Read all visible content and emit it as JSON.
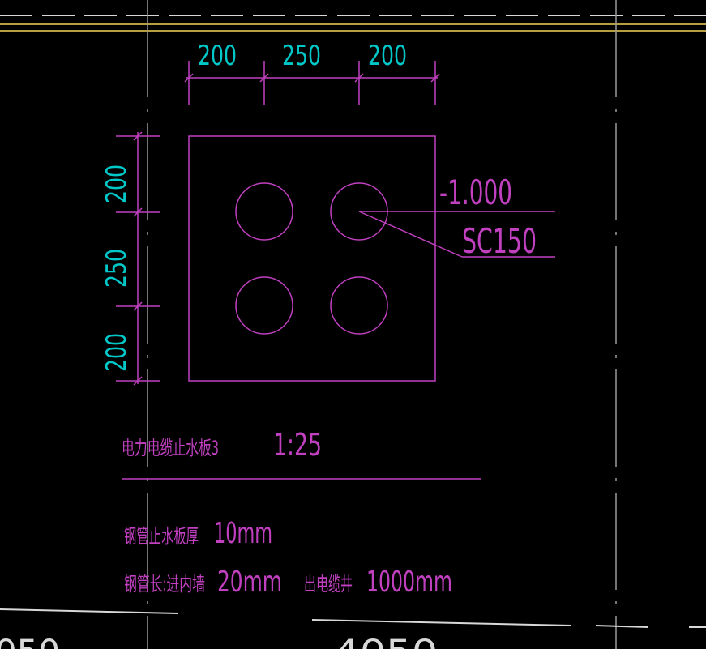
{
  "colors": {
    "background": "#000000",
    "magenta": "#c040c0",
    "cyan": "#00c8c8",
    "white": "#d8d8d8",
    "yellow": "#b8a040",
    "gray": "#9a9a9a"
  },
  "dimensions": {
    "top": [
      "200",
      "250",
      "200"
    ],
    "left": [
      "200",
      "250",
      "200"
    ]
  },
  "annotation": {
    "elevation": "-1.000",
    "pipe": "SC150"
  },
  "title": {
    "name": "电力电缆止水板3",
    "scale": "1:25"
  },
  "notes": {
    "line1_label": "钢管止水板厚",
    "line1_value": "10mm",
    "line2_label": "钢管长:进内墙",
    "line2_value": "20mm",
    "line2_label2": "出电缆井",
    "line2_value2": "1000mm"
  },
  "bottom_dims": {
    "left_partial": "050",
    "center_partial": "4050"
  }
}
